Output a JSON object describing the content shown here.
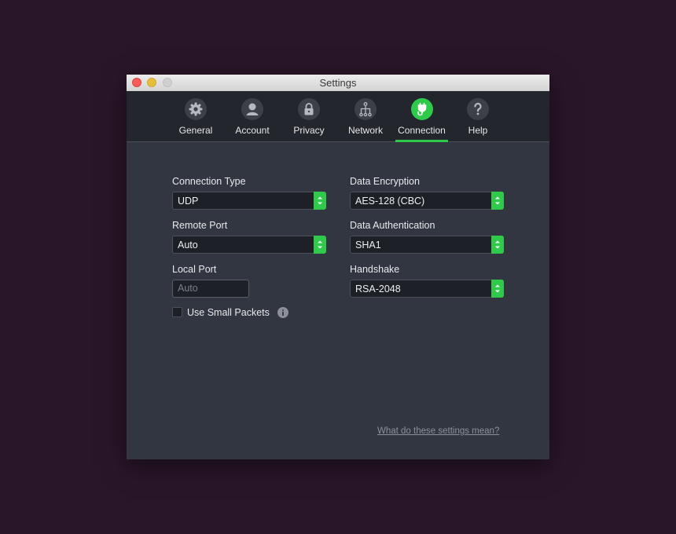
{
  "window": {
    "title": "Settings"
  },
  "toolbar": {
    "tabs": [
      {
        "label": "General",
        "icon": "gear-icon"
      },
      {
        "label": "Account",
        "icon": "user-icon"
      },
      {
        "label": "Privacy",
        "icon": "lock-icon"
      },
      {
        "label": "Network",
        "icon": "network-icon"
      },
      {
        "label": "Connection",
        "icon": "plug-icon",
        "active": true
      },
      {
        "label": "Help",
        "icon": "question-icon"
      }
    ]
  },
  "connection": {
    "connection_type": {
      "label": "Connection Type",
      "value": "UDP"
    },
    "remote_port": {
      "label": "Remote Port",
      "value": "Auto"
    },
    "local_port": {
      "label": "Local Port",
      "placeholder": "Auto"
    },
    "small_packets": {
      "label": "Use Small Packets",
      "checked": false
    },
    "data_encryption": {
      "label": "Data Encryption",
      "value": "AES-128 (CBC)"
    },
    "data_authentication": {
      "label": "Data Authentication",
      "value": "SHA1"
    },
    "handshake": {
      "label": "Handshake",
      "value": "RSA-2048"
    },
    "help_link": "What do these settings mean?"
  },
  "colors": {
    "accent": "#2fca4a",
    "background": "#2a1629",
    "panel": "#323640",
    "toolbar": "#23262d"
  }
}
